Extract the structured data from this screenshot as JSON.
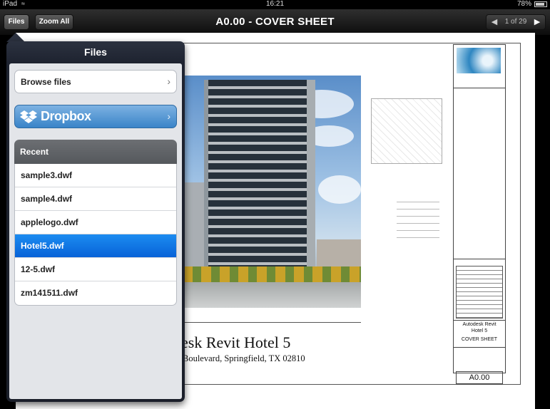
{
  "status": {
    "device": "iPad",
    "time": "16:21",
    "battery": "78%"
  },
  "toolbar": {
    "files_label": "Files",
    "zoom_label": "Zoom All",
    "title": "A0.00 - COVER SHEET",
    "page": "1 of 29"
  },
  "sheet": {
    "project_name": "esk Revit Hotel 5",
    "address": "Boulevard, Springfield, TX 02810",
    "titleblock_name_line1": "Autodesk Revit",
    "titleblock_name_line2": "Hotel 5",
    "titleblock_sheet_name": "COVER SHEET",
    "titleblock_sheet_number": "A0.00"
  },
  "popover": {
    "title": "Files",
    "browse_label": "Browse files",
    "dropbox_label": "Dropbox",
    "recent_label": "Recent",
    "recent_files": [
      "sample3.dwf",
      "sample4.dwf",
      "applelogo.dwf",
      "Hotel5.dwf",
      "12-5.dwf",
      "zm141511.dwf"
    ],
    "selected_file": "Hotel5.dwf"
  },
  "colors": {
    "selection": "#0a6fe0",
    "dropbox": "#3a84c8"
  }
}
